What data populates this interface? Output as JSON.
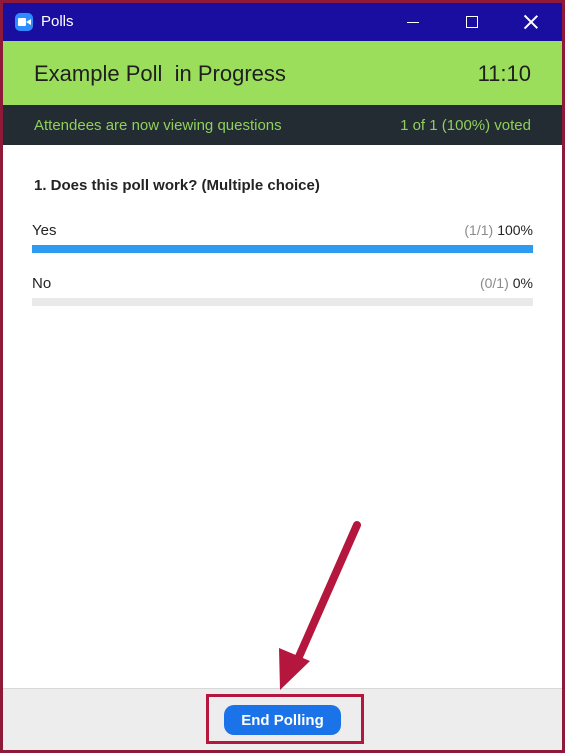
{
  "window": {
    "title": "Polls",
    "app_icon": "zoom-camera-icon"
  },
  "header": {
    "poll_title": "Example Poll  in Progress",
    "time": "11:10",
    "background_color": "#9bde5c"
  },
  "status": {
    "viewing_text": "Attendees are now viewing questions",
    "voted_text": "1 of 1 (100%) voted"
  },
  "question": {
    "text": "1. Does this poll work? (Multiple choice)",
    "options": [
      {
        "label": "Yes",
        "count": "(1/1)",
        "percent": "100%",
        "fill": 1.0
      },
      {
        "label": "No",
        "count": "(0/1)",
        "percent": "0%",
        "fill": 0.0
      }
    ]
  },
  "footer": {
    "end_button_label": "End Polling"
  },
  "annotation": {
    "arrow_color": "#b5163e",
    "highlight_color": "#b5163e"
  }
}
